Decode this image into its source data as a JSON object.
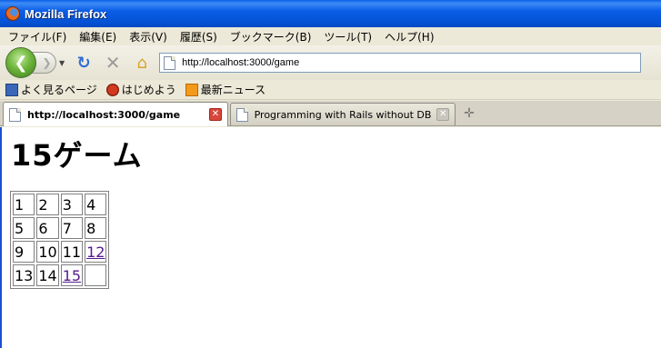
{
  "window": {
    "title": "Mozilla Firefox"
  },
  "menu": [
    "ファイル(F)",
    "編集(E)",
    "表示(V)",
    "履歴(S)",
    "ブックマーク(B)",
    "ツール(T)",
    "ヘルプ(H)"
  ],
  "nav": {
    "url": "http://localhost:3000/game"
  },
  "bookmarks": [
    {
      "label": "よく見るページ",
      "icon": "most-visited-icon"
    },
    {
      "label": "はじめよう",
      "icon": "getting-started-icon"
    },
    {
      "label": "最新ニュース",
      "icon": "rss-feed-icon"
    }
  ],
  "tabs": [
    {
      "label": "http://localhost:3000/game",
      "active": true
    },
    {
      "label": "Programming with Rails without DB",
      "active": false
    }
  ],
  "page": {
    "heading": "15ゲーム",
    "board": [
      [
        {
          "v": "1",
          "link": false
        },
        {
          "v": "2",
          "link": false
        },
        {
          "v": "3",
          "link": false
        },
        {
          "v": "4",
          "link": false
        }
      ],
      [
        {
          "v": "5",
          "link": false
        },
        {
          "v": "6",
          "link": false
        },
        {
          "v": "7",
          "link": false
        },
        {
          "v": "8",
          "link": false
        }
      ],
      [
        {
          "v": "9",
          "link": false
        },
        {
          "v": "10",
          "link": false
        },
        {
          "v": "11",
          "link": false
        },
        {
          "v": "12",
          "link": true
        }
      ],
      [
        {
          "v": "13",
          "link": false
        },
        {
          "v": "14",
          "link": false
        },
        {
          "v": "15",
          "link": true
        },
        {
          "v": "",
          "link": false
        }
      ]
    ]
  }
}
